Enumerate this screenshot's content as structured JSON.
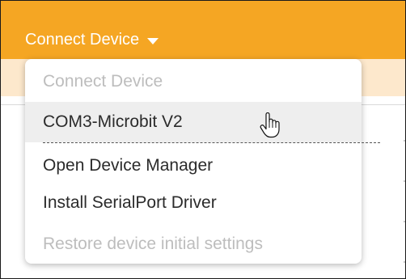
{
  "header": {
    "connect_label": "Connect Device",
    "dropdown_icon": "caret-down-icon"
  },
  "menu": {
    "items": [
      {
        "label": "Connect Device",
        "disabled": true
      },
      {
        "label": "COM3-Microbit V2",
        "disabled": false,
        "hovered": true
      },
      {
        "label": "Open Device Manager",
        "disabled": false
      },
      {
        "label": "Install SerialPort Driver",
        "disabled": false
      },
      {
        "label": "Restore device initial settings",
        "disabled": true
      }
    ]
  },
  "cursor": "hand-pointer-icon",
  "colors": {
    "accent": "#f5a623",
    "accent_light": "#fde8cc",
    "disabled_text": "#bdbdbd",
    "hover_bg": "#eeeeee"
  }
}
